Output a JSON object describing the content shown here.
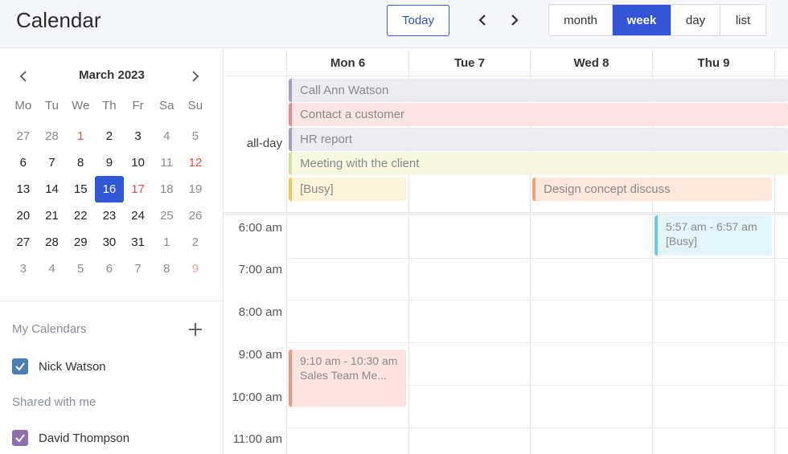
{
  "header": {
    "title": "Calendar",
    "today_label": "Today",
    "views": [
      "month",
      "week",
      "day",
      "list"
    ],
    "active_view": "week"
  },
  "mini_calendar": {
    "title": "March 2023",
    "weekdays": [
      "Mo",
      "Tu",
      "We",
      "Th",
      "Fr",
      "Sa",
      "Su"
    ],
    "weeks": [
      [
        "27",
        "28",
        "1",
        "2",
        "3",
        "4",
        "5"
      ],
      [
        "6",
        "7",
        "8",
        "9",
        "10",
        "11",
        "12"
      ],
      [
        "13",
        "14",
        "15",
        "16",
        "17",
        "18",
        "19"
      ],
      [
        "20",
        "21",
        "22",
        "23",
        "24",
        "25",
        "26"
      ],
      [
        "27",
        "28",
        "29",
        "30",
        "31",
        "1",
        "2"
      ],
      [
        "3",
        "4",
        "5",
        "6",
        "7",
        "8",
        "9"
      ]
    ],
    "selected_day": "16"
  },
  "sidebar": {
    "my_calendars_label": "My Calendars",
    "my_calendars": [
      {
        "name": "Nick Watson",
        "color": "#4a7fb5"
      }
    ],
    "shared_label": "Shared with me",
    "shared_calendars": [
      {
        "name": "David Thompson",
        "color": "#8e6fae"
      }
    ]
  },
  "week": {
    "columns": [
      "Mon 6",
      "Tue 7",
      "Wed 8",
      "Thu 9"
    ],
    "allday_label": "all-day",
    "allday_events": [
      {
        "title": "Call Ann Watson",
        "bg": "#ebebf0",
        "border": "#a89bc4"
      },
      {
        "title": "Contact a customer",
        "bg": "#fde4e4",
        "border": "#e98a8f"
      },
      {
        "title": "HR report",
        "bg": "#ebebf0",
        "border": "#a89bc4"
      },
      {
        "title": "Meeting with the client",
        "bg": "#f6f8e4",
        "border": "#d8df9e"
      },
      {
        "title": "[Busy]",
        "bg": "#fdf4dc",
        "border": "#f1c65a"
      },
      {
        "title": "Design concept discuss",
        "bg": "#fde7dc",
        "border": "#f0a47a"
      }
    ],
    "hours": [
      "6:00 am",
      "7:00 am",
      "8:00 am",
      "9:00 am",
      "10:00 am",
      "11:00 am"
    ],
    "timed_events": [
      {
        "time": "5:57 am - 6:57 am",
        "title": "[Busy]",
        "bg": "#e3f4fb",
        "border": "#6ec9e6"
      },
      {
        "time": "9:10 am - 10:30 am",
        "title": "Sales Team Me...",
        "bg": "#fde4e1",
        "border": "#f2937b"
      }
    ]
  }
}
